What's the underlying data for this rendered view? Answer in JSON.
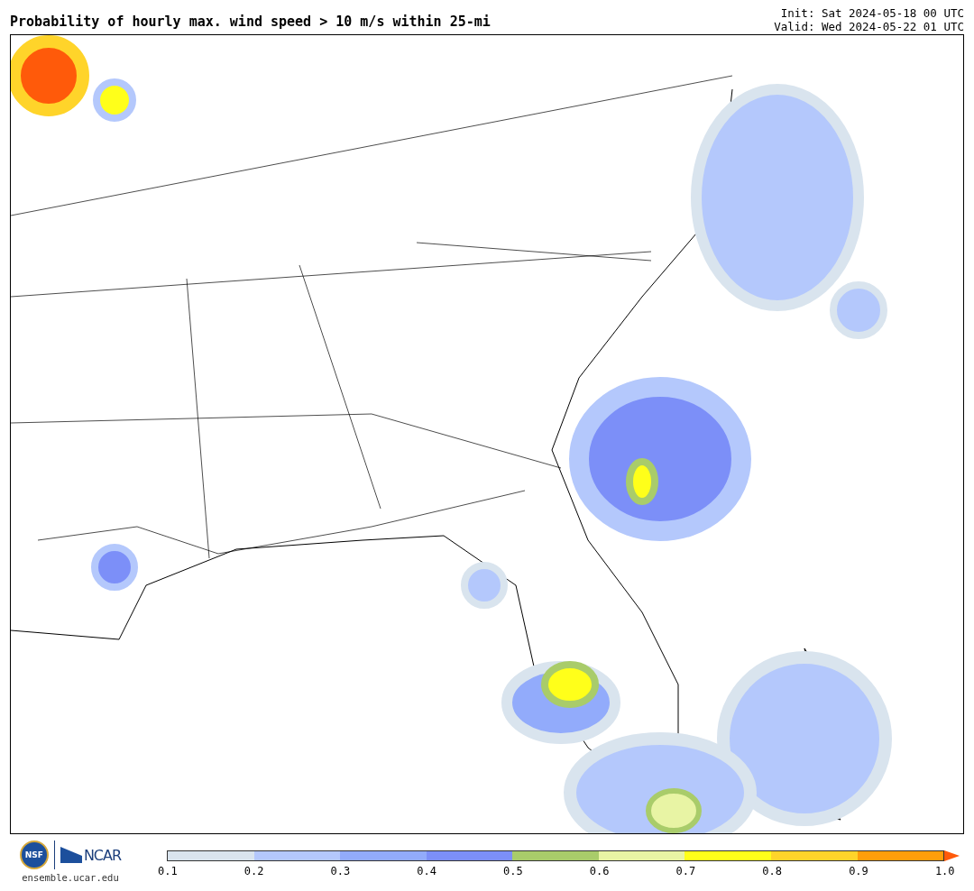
{
  "title": "Probability of hourly max. wind speed > 10 m/s within 25-mi",
  "init": "Init: Sat 2024-05-18 00 UTC",
  "valid": "Valid: Wed 2024-05-22 01 UTC",
  "logos": {
    "nsf": "NSF",
    "ncar": "NCAR",
    "site": "ensemble.ucar.edu"
  },
  "colorbar": {
    "bins": [
      {
        "color": "#d9e4ee"
      },
      {
        "color": "#b4c8fc"
      },
      {
        "color": "#92abfb"
      },
      {
        "color": "#7c8ff8"
      },
      {
        "color": "#a9cc6a"
      },
      {
        "color": "#e8f4a4"
      },
      {
        "color": "#ffff1a"
      },
      {
        "color": "#ffd42a"
      },
      {
        "color": "#ff9e0a"
      }
    ],
    "overflow": {
      "color": "#ff5a0a"
    },
    "ticks": [
      "0.1",
      "0.2",
      "0.3",
      "0.4",
      "0.5",
      "0.6",
      "0.7",
      "0.8",
      "0.9",
      "1.0"
    ]
  }
}
